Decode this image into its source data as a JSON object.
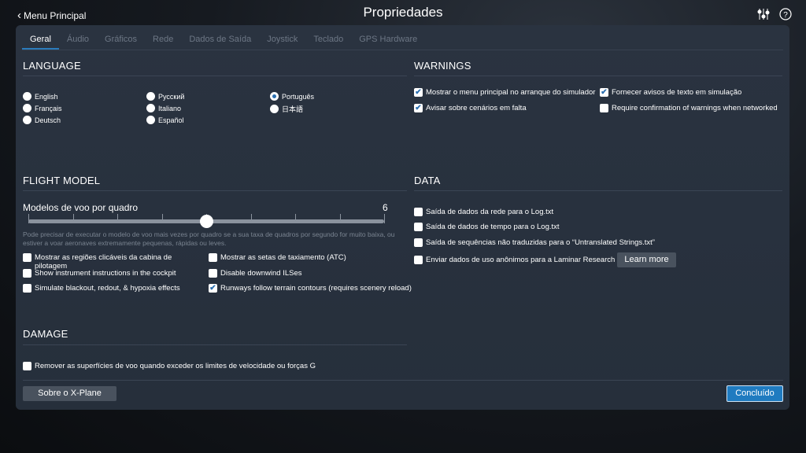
{
  "header": {
    "back_label": "Menu Principal",
    "title": "Propriedades",
    "icons": [
      "sliders-icon",
      "help-icon"
    ]
  },
  "tabs": [
    {
      "label": "Geral",
      "active": true
    },
    {
      "label": "Áudio"
    },
    {
      "label": "Gráficos"
    },
    {
      "label": "Rede"
    },
    {
      "label": "Dados de Saída"
    },
    {
      "label": "Joystick"
    },
    {
      "label": "Teclado"
    },
    {
      "label": "GPS Hardware"
    }
  ],
  "language": {
    "title": "LANGUAGE",
    "options": [
      {
        "label": "English"
      },
      {
        "label": "Français"
      },
      {
        "label": "Deutsch"
      },
      {
        "label": "Русский"
      },
      {
        "label": "Italiano"
      },
      {
        "label": "Español"
      },
      {
        "label": "Português",
        "selected": true
      },
      {
        "label": "日本語"
      }
    ]
  },
  "warnings": {
    "title": "WARNINGS",
    "items": [
      {
        "label": "Mostrar o menu principal no arranque do simulador",
        "checked": true
      },
      {
        "label": "Fornecer avisos de texto em simulação",
        "checked": true
      },
      {
        "label": "Avisar sobre cenários em falta",
        "checked": true
      },
      {
        "label": "Require confirmation of warnings when networked",
        "checked": false
      }
    ]
  },
  "flight_model": {
    "title": "FLIGHT MODEL",
    "slider_label": "Modelos de voo por quadro",
    "slider_value": "6",
    "slider_fraction": 0.5,
    "hint": "Pode precisar de executar o modelo de voo mais vezes por quadro se a sua taxa de quadros por segundo for muito baixa, ou estiver a voar aeronaves extremamente pequenas, rápidas ou leves.",
    "items": [
      {
        "label": "Mostrar as regiões clicáveis da cabina de pilotagem",
        "checked": false
      },
      {
        "label": "Mostrar as setas de taxiamento (ATC)",
        "checked": false
      },
      {
        "label": "Show instrument instructions in the cockpit",
        "checked": false
      },
      {
        "label": "Disable downwind ILSes",
        "checked": false
      },
      {
        "label": "Simulate blackout, redout, & hypoxia effects",
        "checked": false
      },
      {
        "label": "Runways follow terrain contours (requires scenery reload)",
        "checked": true
      }
    ]
  },
  "data": {
    "title": "DATA",
    "items": [
      {
        "label": "Saída de dados da rede para o Log.txt",
        "checked": false
      },
      {
        "label": "Saída de dados de tempo para o Log.txt",
        "checked": false
      },
      {
        "label": "Saída de sequências não traduzidas para o “Untranslated Strings.txt”",
        "checked": false
      },
      {
        "label": "Enviar dados de uso anônimos para a Laminar Research",
        "checked": false
      }
    ],
    "learn_more": "Learn more"
  },
  "damage": {
    "title": "DAMAGE",
    "items": [
      {
        "label": "Remover as superfícies de voo quando exceder os limites de velocidade ou forças G",
        "checked": false
      }
    ]
  },
  "footer": {
    "about": "Sobre o X-Plane",
    "done": "Concluído"
  },
  "colors": {
    "accent": "#2b7bbb",
    "panel": "#28313e"
  }
}
